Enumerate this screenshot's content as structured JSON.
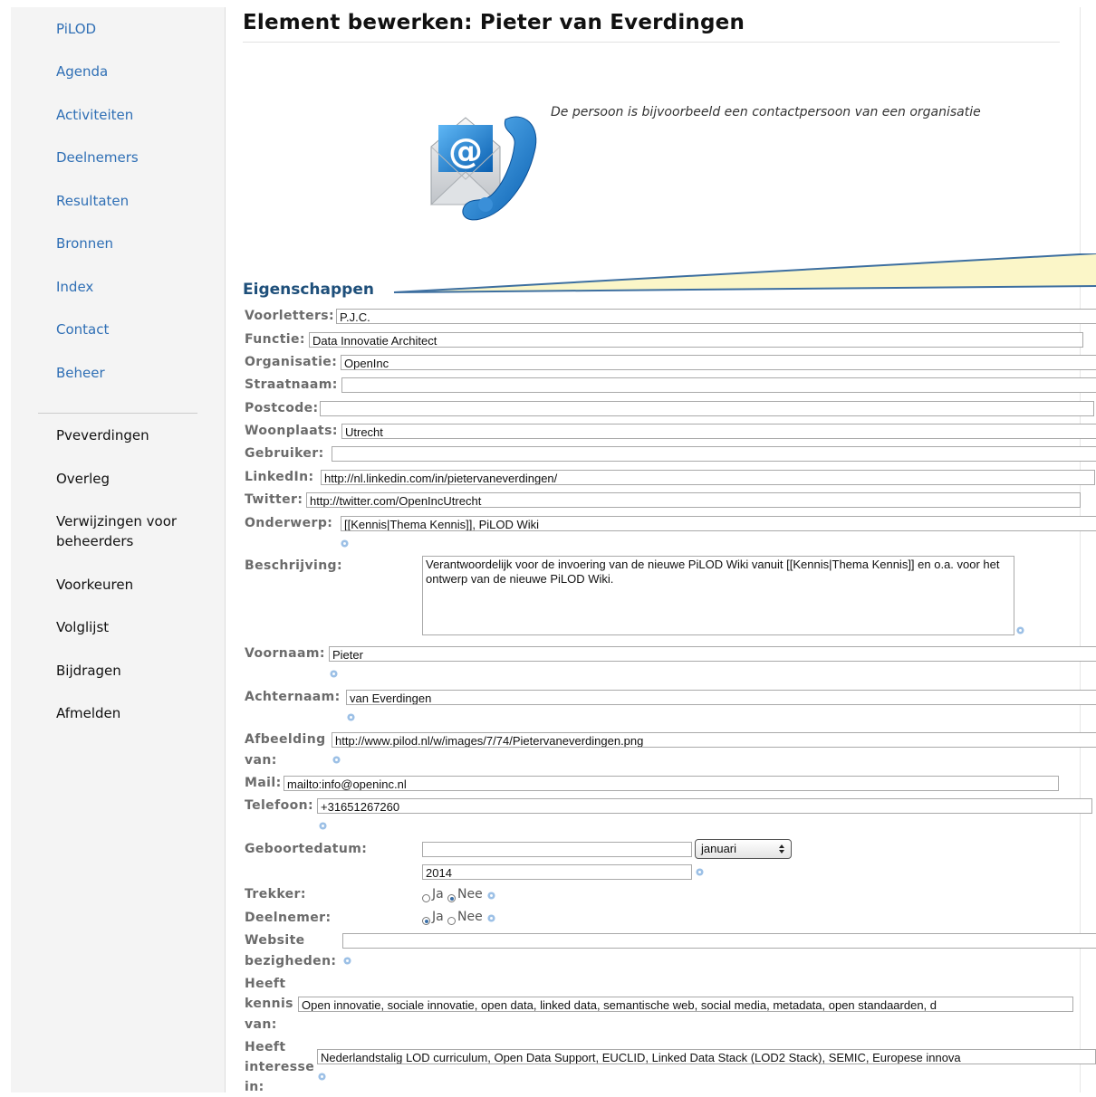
{
  "sidebar": {
    "nav": [
      "PiLOD",
      "Agenda",
      "Activiteiten",
      "Deelnemers",
      "Resultaten",
      "Bronnen",
      "Index",
      "Contact",
      "Beheer"
    ],
    "personal": [
      "Pveverdingen",
      "Overleg",
      "Verwijzingen voor beheerders",
      "Voorkeuren",
      "Volglijst",
      "Bijdragen",
      "Afmelden"
    ]
  },
  "page": {
    "title": "Element bewerken: Pieter van Everdingen",
    "note": "De persoon is bijvoorbeeld een contactpersoon van een organisatie",
    "section": "Eigenschappen"
  },
  "form": {
    "voorletters": {
      "label": "Voorletters:",
      "value": "P.J.C."
    },
    "functie": {
      "label": "Functie:",
      "value": "Data Innovatie Architect"
    },
    "organisatie": {
      "label": "Organisatie:",
      "value": "OpenInc"
    },
    "straatnaam": {
      "label": "Straatnaam:",
      "value": ""
    },
    "postcode": {
      "label": "Postcode:",
      "value": ""
    },
    "woonplaats": {
      "label": "Woonplaats:",
      "value": "Utrecht"
    },
    "gebruiker": {
      "label": "Gebruiker:",
      "value": ""
    },
    "linkedin": {
      "label": "LinkedIn:",
      "value": "http://nl.linkedin.com/in/pietervaneverdingen/"
    },
    "twitter": {
      "label": "Twitter:",
      "value": "http://twitter.com/OpenIncUtrecht"
    },
    "onderwerp": {
      "label": "Onderwerp:",
      "value": "[[Kennis|Thema Kennis]], PiLOD Wiki"
    },
    "beschrijving": {
      "label": "Beschrijving:",
      "value": "Verantwoordelijk voor de invoering van de nieuwe PiLOD Wiki vanuit [[Kennis|Thema Kennis]] en o.a. voor het ontwerp van de nieuwe PiLOD Wiki."
    },
    "voornaam": {
      "label": "Voornaam:",
      "value": "Pieter"
    },
    "achternaam": {
      "label": "Achternaam:",
      "value": "van Everdingen"
    },
    "afbeelding": {
      "label_1": "Afbeelding",
      "label_2": "van:",
      "value": "http://www.pilod.nl/w/images/7/74/Pietervaneverdingen.png"
    },
    "mail": {
      "label": "Mail:",
      "value": "mailto:info@openinc.nl"
    },
    "telefoon": {
      "label": "Telefoon:",
      "value": "+31651267260"
    },
    "geboortedatum": {
      "label": "Geboortedatum:",
      "day": "",
      "month": "januari",
      "year": "2014"
    },
    "trekker": {
      "label": "Trekker:",
      "options": [
        "Ja",
        "Nee"
      ],
      "selected": "Nee"
    },
    "deelnemer": {
      "label": "Deelnemer:",
      "options": [
        "Ja",
        "Nee"
      ],
      "selected": "Ja"
    },
    "website": {
      "label_1": "Website",
      "label_2": "bezigheden:",
      "value": ""
    },
    "kennis": {
      "label_1": "Heeft",
      "label_2": "kennis",
      "label_3": "van:",
      "value": "Open innovatie, sociale innovatie, open data, linked data, semantische web, social media, metadata, open standaarden, d"
    },
    "interesse": {
      "label_1": "Heeft",
      "label_2": "interesse",
      "label_3": "in:",
      "value": "Nederlandstalig LOD curriculum, Open Data Support, EUCLID, Linked Data Stack (LOD2 Stack), SEMIC, Europese innova"
    }
  },
  "colors": {
    "link": "#2f6fb5",
    "section": "#1e4f7a",
    "callout": "#fbf6c8"
  }
}
